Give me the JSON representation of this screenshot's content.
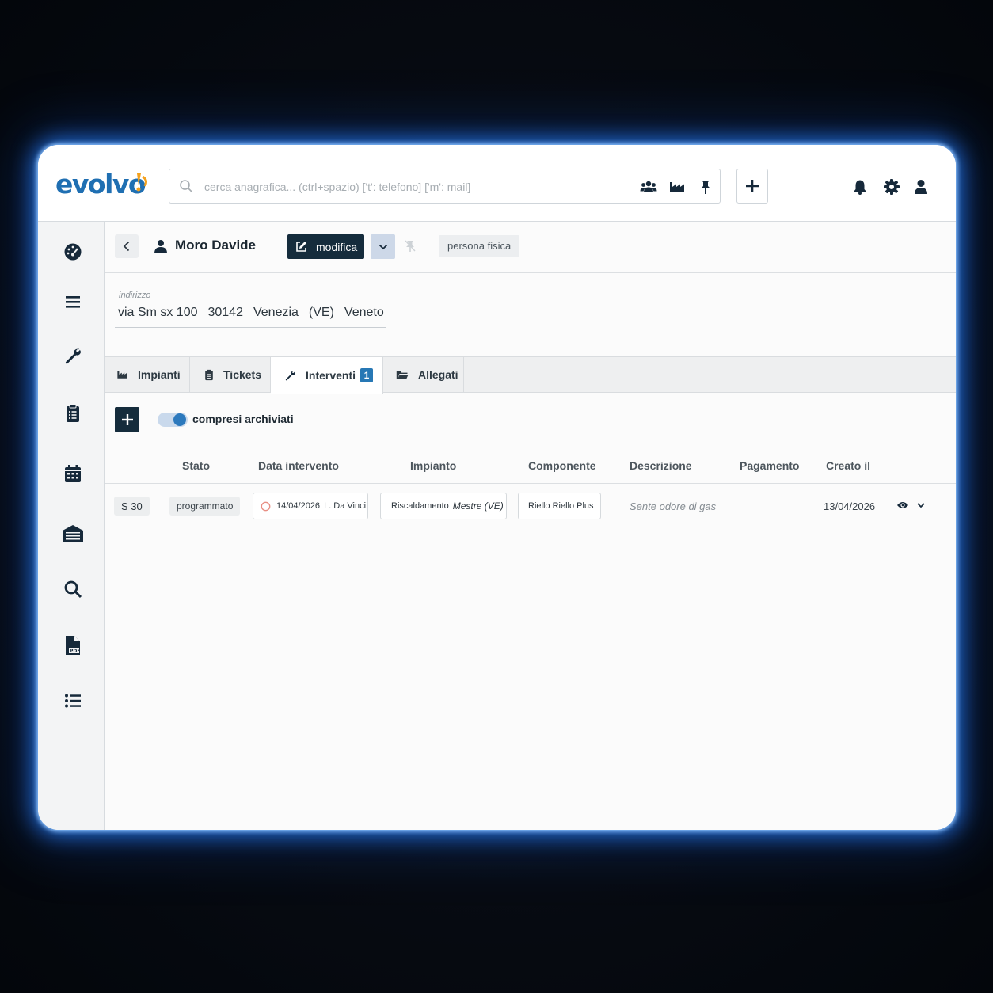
{
  "app": {
    "logo_text": "evolvo"
  },
  "search": {
    "placeholder": "cerca anagrafica... (ctrl+spazio) ['t': telefono] ['m': mail]"
  },
  "header": {
    "name": "Moro Davide",
    "edit_label": "modifica",
    "type_badge": "persona fisica"
  },
  "address": {
    "label": "indirizzo",
    "street": "via Sm sx 100",
    "zip": "30142",
    "city": "Venezia",
    "province": "(VE)",
    "region": "Veneto"
  },
  "tabs": [
    {
      "label": "Impianti",
      "icon": "factory-icon"
    },
    {
      "label": "Tickets",
      "icon": "clipboard-icon"
    },
    {
      "label": "Interventi",
      "icon": "wrench-icon",
      "count": "1",
      "active": true
    },
    {
      "label": "Allegati",
      "icon": "folder-open-icon"
    }
  ],
  "filter": {
    "toggle_label": "compresi archiviati",
    "toggle_on": true
  },
  "table": {
    "columns": [
      "Stato",
      "Data intervento",
      "Impianto",
      "Componente",
      "Descrizione",
      "Pagamento",
      "Creato il"
    ],
    "rows": [
      {
        "code": "S 30",
        "stato": "programmato",
        "data": "14/04/2026",
        "tecnico": "L. Da Vinci",
        "impianto_tipo": "Riscaldamento",
        "impianto_luogo": "Mestre (VE)",
        "componente": "Riello Riello Plus",
        "descrizione": "Sente odore di gas",
        "pagamento": "",
        "creato": "13/04/2026"
      }
    ]
  },
  "sidebar": {
    "icons": [
      "dashboard-icon",
      "menu-icon",
      "wrench-icon",
      "clipboard-icon",
      "calendar-icon",
      "warehouse-icon",
      "search-icon",
      "pdf-file-icon",
      "list-icon"
    ]
  },
  "colors": {
    "brand": "#1f6fb2",
    "accent_orange": "#f4a11c",
    "dark_button": "#152c3c",
    "badge_blue": "#2778b5"
  }
}
